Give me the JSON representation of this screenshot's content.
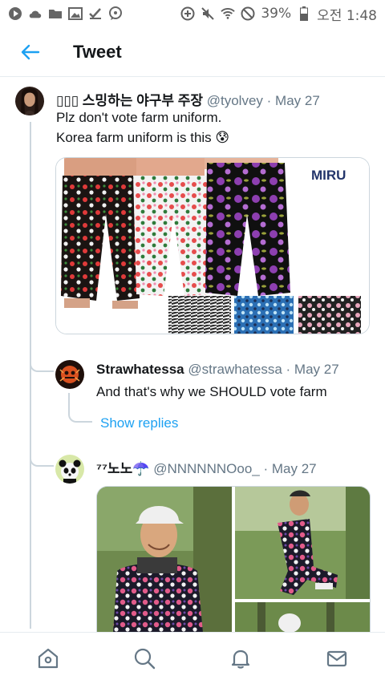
{
  "status_bar": {
    "battery": "39%",
    "time": "오전 1:48"
  },
  "header": {
    "title": "Tweet"
  },
  "tweets": [
    {
      "name": "▯▯▯ 스밍하는 야구부 주장",
      "handle": "@tyolvey",
      "dot": "·",
      "date": "May 27",
      "text_line1": "Plz don't vote farm uniform.",
      "text_line2": "Korea farm uniform is this 😰",
      "media": {
        "logo": "MIRU"
      }
    },
    {
      "name": "Strawhatessa",
      "handle": "@strawhatessa",
      "dot": "·",
      "date": "May 27",
      "text_line1": "And that's why we SHOULD vote farm",
      "show_replies": "Show replies"
    },
    {
      "name": "⁷⁷노노☂️",
      "handle": "@NNNNNNOoo_",
      "dot": "·",
      "date": "May 27"
    }
  ],
  "icons": {
    "back": "back-arrow-icon",
    "home": "home-icon",
    "search": "search-icon",
    "notifications": "bell-icon",
    "messages": "mail-icon"
  },
  "colors": {
    "accent": "#1da1f2",
    "muted": "#657786",
    "divider": "#e6ecf0"
  }
}
